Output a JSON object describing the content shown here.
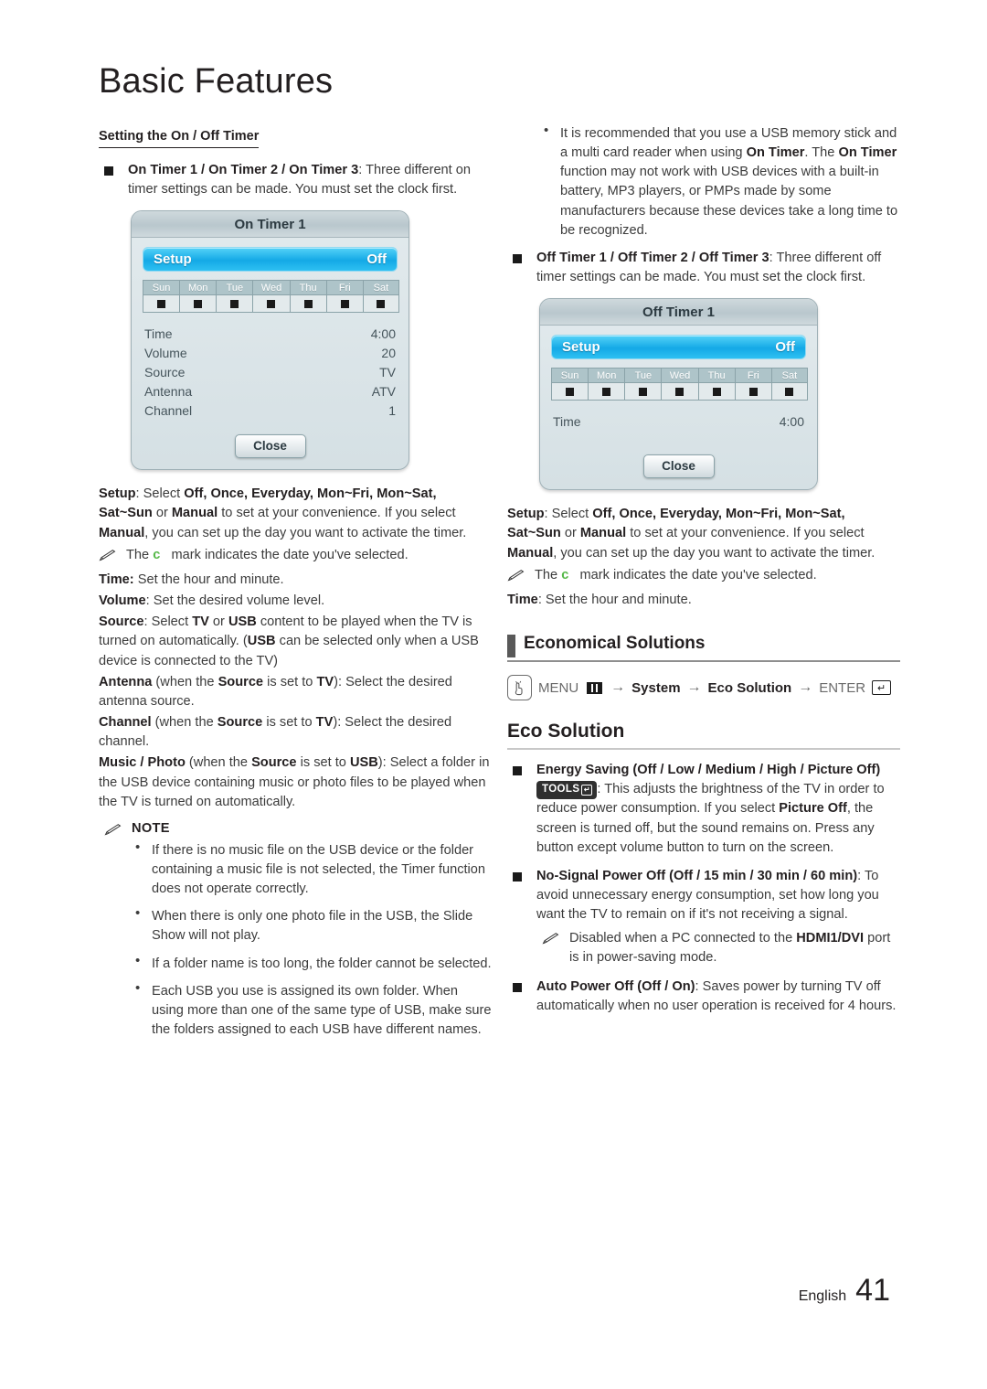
{
  "page": {
    "chapter_title": "Basic Features",
    "footer_language": "English",
    "footer_page_number": "41",
    "accent_green": "#55b848",
    "osd_accent_blue": "#14a9e6",
    "osd_background": "#dce5e8"
  },
  "left_column": {
    "sub_heading": "Setting the On / Off Timer",
    "on_timer_item": {
      "bold": "On Timer 1 / On Timer 2 / On Timer 3",
      "rest": ": Three different on timer settings can be made. You must set the clock first."
    },
    "on_timer_dialog": {
      "title": "On Timer  1",
      "setup_label": "Setup",
      "setup_value": "Off",
      "days": [
        "Sun",
        "Mon",
        "Tue",
        "Wed",
        "Thu",
        "Fri",
        "Sat"
      ],
      "rows": [
        {
          "label": "Time",
          "value": "4:00"
        },
        {
          "label": "Volume",
          "value": "20"
        },
        {
          "label": "Source",
          "value": "TV"
        },
        {
          "label": "Antenna",
          "value": "ATV"
        },
        {
          "label": "Channel",
          "value": "1"
        }
      ],
      "close_label": "Close"
    },
    "setup_desc": {
      "label": "Setup",
      "text_1": ": Select ",
      "options": "Off, Once, Everyday, Mon~Fri, Mon~Sat, Sat~Sun",
      "text_2": " or ",
      "manual": "Manual",
      "text_3": " to set at your convenience. If you select ",
      "manual_2": "Manual",
      "text_4": ", you can set up the day you want to activate the timer."
    },
    "note_c_mark": {
      "before": "The ",
      "mark": "c",
      "after": " mark indicates the date you've selected."
    },
    "time_desc": {
      "label": "Time:",
      "text": " Set the hour and  minute."
    },
    "volume_desc": {
      "label": "Volume",
      "text": ": Set the desired volume level."
    },
    "source_desc": {
      "label": "Source",
      "text_1": ": Select ",
      "tv": "TV",
      "text_2": " or ",
      "usb": "USB",
      "text_3": " content to be played when the TV is turned on automatically. (",
      "usb_2": "USB",
      "text_4": " can be selected only when a USB device is connected to the TV)"
    },
    "antenna_desc": {
      "label": "Antenna",
      "text_1": " (when the ",
      "source": "Source",
      "text_2": " is set to ",
      "tv": "TV",
      "text_3": "): Select the desired antenna source."
    },
    "channel_desc": {
      "label": "Channel",
      "text_1": " (when the ",
      "source": "Source",
      "text_2": " is set to ",
      "tv": "TV",
      "text_3": "): Select the desired channel."
    },
    "music_photo_desc": {
      "label": "Music / Photo",
      "text_1": " (when the ",
      "source": "Source",
      "text_2": " is set to ",
      "usb": "USB",
      "text_3": "): Select a folder in the USB device containing music or photo files to be played when the TV is turned on automatically."
    },
    "note_heading": "NOTE",
    "note_bullets": [
      "If there is no music file on the USB device or the folder containing a music file is not selected, the Timer function does not operate correctly.",
      "When there is only one photo file in the USB, the Slide Show will not play.",
      "If a folder name is too long, the folder cannot be selected.",
      "Each USB you use is assigned its own folder. When using more than one of the same type of USB, make sure the folders assigned to each USB have different names."
    ]
  },
  "right_column": {
    "usb_bullet": {
      "text_1": "It is recommended that you use a USB memory stick and a multi card reader when using ",
      "on_timer_1": "On Timer",
      "text_2": ". The ",
      "on_timer_2": "On Timer",
      "text_3": " function may not work with USB devices with a built-in battery, MP3 players, or PMPs made by some manufacturers because these devices take a long time to be recognized."
    },
    "off_timer_item": {
      "bold": "Off Timer 1 / Off Timer 2 / Off Timer 3",
      "rest": ": Three different off timer settings can be made. You must set the clock first."
    },
    "off_timer_dialog": {
      "title": "Off Timer  1",
      "setup_label": "Setup",
      "setup_value": "Off",
      "days": [
        "Sun",
        "Mon",
        "Tue",
        "Wed",
        "Thu",
        "Fri",
        "Sat"
      ],
      "rows": [
        {
          "label": "Time",
          "value": "4:00"
        }
      ],
      "close_label": "Close"
    },
    "setup_desc": {
      "label": "Setup",
      "text_1": ": Select ",
      "options": "Off, Once, Everyday, Mon~Fri, Mon~Sat, Sat~Sun",
      "text_2": " or ",
      "manual": "Manual",
      "text_3": " to set at your convenience. If you select ",
      "manual_2": "Manual",
      "text_4": ", you can set up the day you want to activate the timer."
    },
    "note_c_mark": {
      "before": "The ",
      "mark": "c",
      "after": " mark indicates the date you've selected."
    },
    "time_desc": {
      "label": "Time",
      "text": ": Set the hour and minute."
    },
    "section_heading": "Economical Solutions",
    "menu_path": {
      "menu": "MENU",
      "arrow": "→",
      "system": "System",
      "eco_solution": "Eco Solution",
      "enter": "ENTER",
      "enter_glyph": "↵"
    },
    "sub_section_heading": "Eco Solution",
    "energy_saving": {
      "bold_1": "Energy Saving (Off / Low / Medium / High / Picture Off)",
      "tools_badge": "TOOLS",
      "text_1": ": This adjusts the brightness of the TV in order to reduce power consumption. If you select ",
      "picture_off": "Picture Off",
      "text_2": ", the screen is turned off, but the sound remains on. Press any button except volume button to turn on the screen."
    },
    "no_signal_power_off": {
      "bold": "No-Signal Power Off (Off / 15 min / 30 min / 60 min)",
      "text": ": To avoid unnecessary energy consumption, set how long you want the TV to remain on if it's not receiving a signal.",
      "note_before": "Disabled when a PC connected to the ",
      "note_bold": "HDMI1/DVI",
      "note_after": " port is in power-saving mode."
    },
    "auto_power_off": {
      "bold": "Auto Power Off (Off / On)",
      "text": ": Saves power by turning TV off automatically when no user operation is received for 4 hours."
    }
  }
}
